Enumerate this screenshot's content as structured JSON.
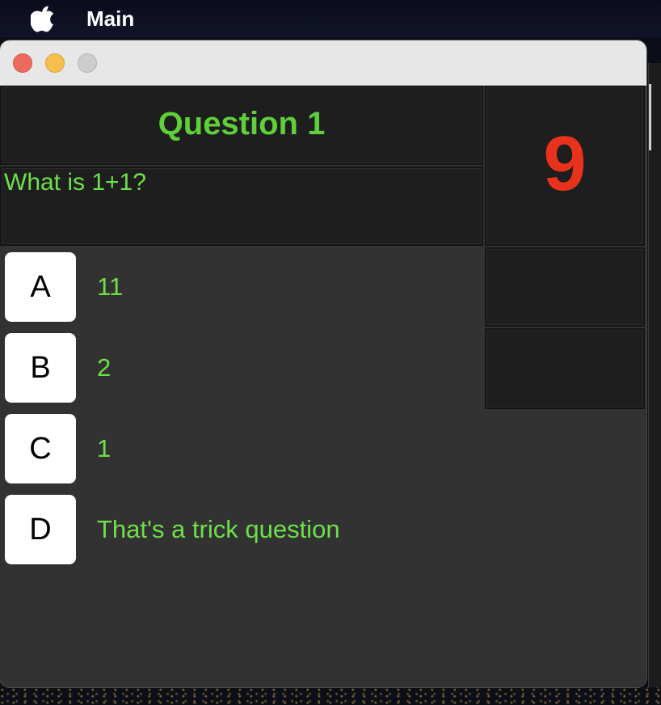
{
  "menubar": {
    "app_name": "Main",
    "logo": "apple-logo-icon"
  },
  "window": {
    "controls": [
      "close",
      "minimize",
      "zoom"
    ]
  },
  "quiz": {
    "title": "Question 1",
    "question": "What is 1+1?",
    "timer": "9",
    "choices": [
      {
        "letter": "A",
        "text": "11"
      },
      {
        "letter": "B",
        "text": "2"
      },
      {
        "letter": "C",
        "text": "1"
      },
      {
        "letter": "D",
        "text": "That's a trick question"
      }
    ]
  },
  "colors": {
    "question_green": "#5fcf3a",
    "answer_green": "#6ee04a",
    "timer_red": "#e8321c",
    "panel_bg": "#1e1e1e",
    "window_bg": "#323232"
  }
}
